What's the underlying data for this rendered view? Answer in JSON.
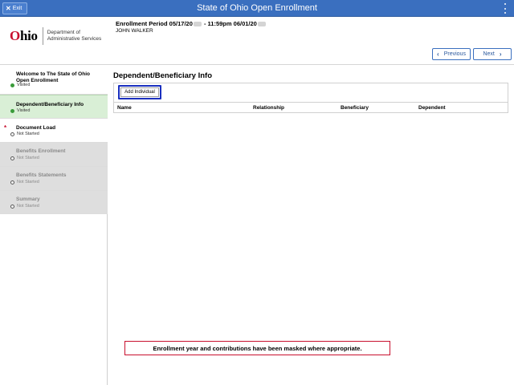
{
  "app": {
    "title": "State of Ohio Open Enrollment",
    "exit_label": "Exit",
    "exit_icon": "close-icon",
    "menu_icon": "kebab-menu-icon",
    "accent_color": "#3a6fbf"
  },
  "header": {
    "logo_text_o": "O",
    "logo_text_rest": "hio",
    "logo_dept_line1": "Department of",
    "logo_dept_line2": "Administrative Services",
    "enrollment_label": "Enrollment Period 05/17/20",
    "enrollment_mid": " - 11:59pm 06/01/20",
    "user_name": "JOHN WALKER",
    "previous_label": "Previous",
    "next_label": "Next"
  },
  "sidebar": {
    "steps": [
      {
        "title": "Welcome to The State of Ohio Open Enrollment",
        "status": "Visited"
      },
      {
        "title": "Dependent/Beneficiary Info",
        "status": "Visited"
      },
      {
        "title": "Document Load",
        "status": "Not Started",
        "required": "*"
      },
      {
        "title": "Benefits Enrollment",
        "status": "Not Started"
      },
      {
        "title": "Benefits Statements",
        "status": "Not Started"
      },
      {
        "title": "Summary",
        "status": "Not Started"
      }
    ]
  },
  "main": {
    "page_title": "Dependent/Beneficiary Info",
    "add_button_label": "Add Individual",
    "columns": [
      "Name",
      "Relationship",
      "Beneficiary",
      "Dependent"
    ],
    "notice": "Enrollment year and contributions have been masked where appropriate."
  }
}
